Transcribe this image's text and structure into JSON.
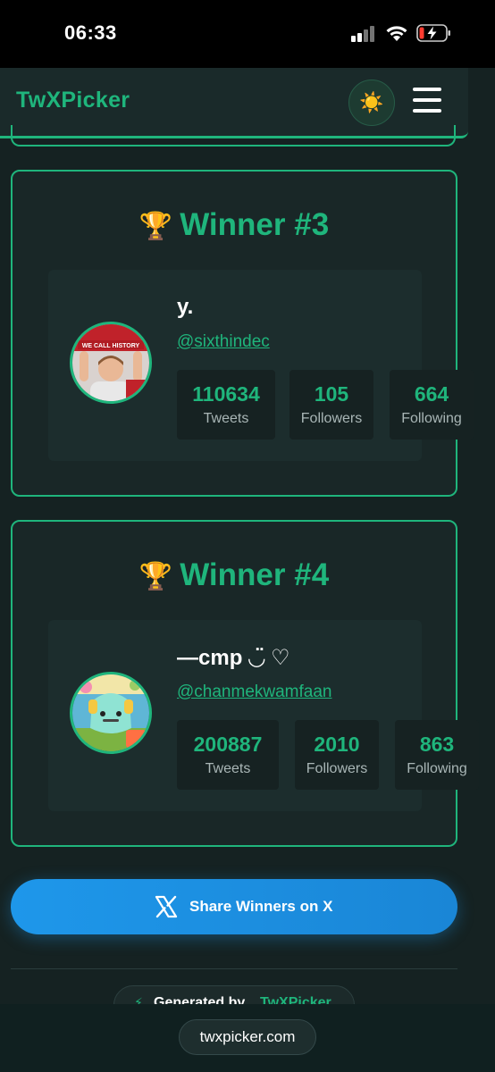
{
  "status_bar": {
    "time": "06:33"
  },
  "header": {
    "brand": "TwXPicker",
    "theme_icon": "☀️"
  },
  "winners": [
    {
      "title": "Winner #3",
      "display_name": "y.",
      "handle": "@sixthindec",
      "stats": [
        {
          "value": "110634",
          "label": "Tweets"
        },
        {
          "value": "105",
          "label": "Followers"
        },
        {
          "value": "664",
          "label": "Following"
        }
      ]
    },
    {
      "title": "Winner #4",
      "display_name": "—cmp ◡̈ ♡",
      "handle": "@chanmekwamfaan",
      "stats": [
        {
          "value": "200887",
          "label": "Tweets"
        },
        {
          "value": "2010",
          "label": "Followers"
        },
        {
          "value": "863",
          "label": "Following"
        }
      ]
    }
  ],
  "share_button": {
    "label": "Share Winners on X"
  },
  "footer": {
    "generated_by": "Generated by",
    "brand": "TwXPicker"
  },
  "browser": {
    "url": "twxpicker.com"
  },
  "colors": {
    "accent": "#1fb57c",
    "share": "#1d9bf0",
    "background": "#152222"
  }
}
